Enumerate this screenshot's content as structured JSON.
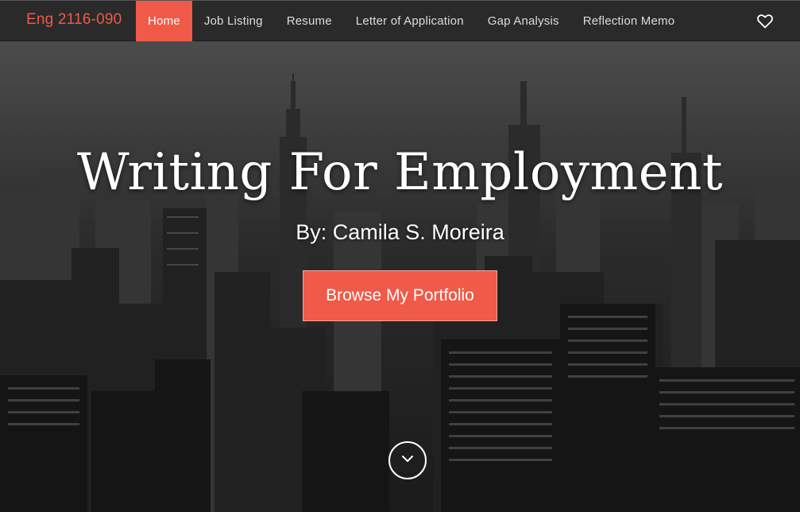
{
  "navbar": {
    "brand": "Eng 2116-090",
    "items": [
      {
        "label": "Home",
        "active": true
      },
      {
        "label": "Job Listing",
        "active": false
      },
      {
        "label": "Resume",
        "active": false
      },
      {
        "label": "Letter of Application",
        "active": false
      },
      {
        "label": "Gap Analysis",
        "active": false
      },
      {
        "label": "Reflection Memo",
        "active": false
      }
    ],
    "right_icon": "heart-icon"
  },
  "hero": {
    "title": "Writing For Employment",
    "byline": "By: Camila S. Moreira",
    "cta_label": "Browse My Portfolio",
    "scroll_icon": "chevron-down-icon"
  },
  "colors": {
    "accent": "#f05a48",
    "navbar_bg": "#2a2a2a",
    "text": "#ffffff"
  }
}
